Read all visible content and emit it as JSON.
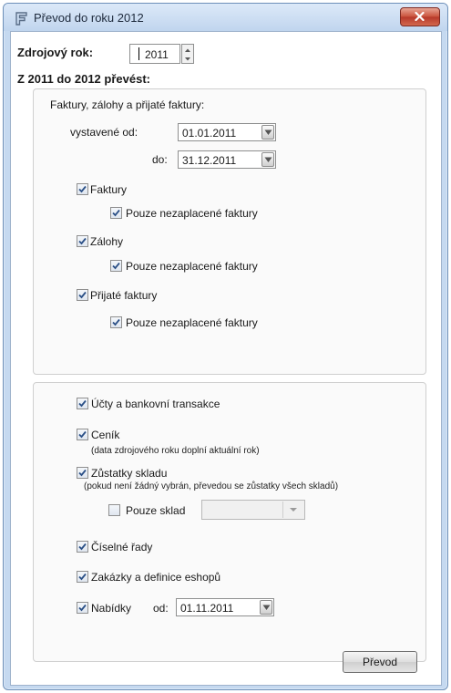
{
  "window": {
    "title": "Převod do roku 2012"
  },
  "source_year": {
    "label": "Zdrojový rok:",
    "value": "2011"
  },
  "transfer_heading": "Z 2011 do 2012 převést:",
  "invoices_group": {
    "heading": "Faktury, zálohy a přijaté faktury:",
    "issued_from_label": "vystavené od:",
    "issued_from_value": "01.01.2011",
    "to_label": "do:",
    "to_value": "31.12.2011",
    "faktury": "Faktury",
    "faktury_unpaid": "Pouze nezaplacené faktury",
    "zalohy": "Zálohy",
    "zalohy_unpaid": "Pouze nezaplacené faktury",
    "prijate": "Přijaté faktury",
    "prijate_unpaid": "Pouze nezaplacené faktury"
  },
  "other_group": {
    "accounts": "Účty a bankovní transakce",
    "pricelist": "Ceník",
    "pricelist_note": "(data zdrojového roku doplní aktuální rok)",
    "stock": "Zůstatky skladu",
    "stock_note": "(pokud není žádný vybrán, převedou se zůstatky všech skladů)",
    "only_stock": "Pouze sklad",
    "number_series": "Číselné řady",
    "orders": "Zakázky a definice eshopů",
    "offers": "Nabídky",
    "offers_from_label": "od:",
    "offers_from_value": "01.11.2011"
  },
  "transfer_button": "Převod"
}
